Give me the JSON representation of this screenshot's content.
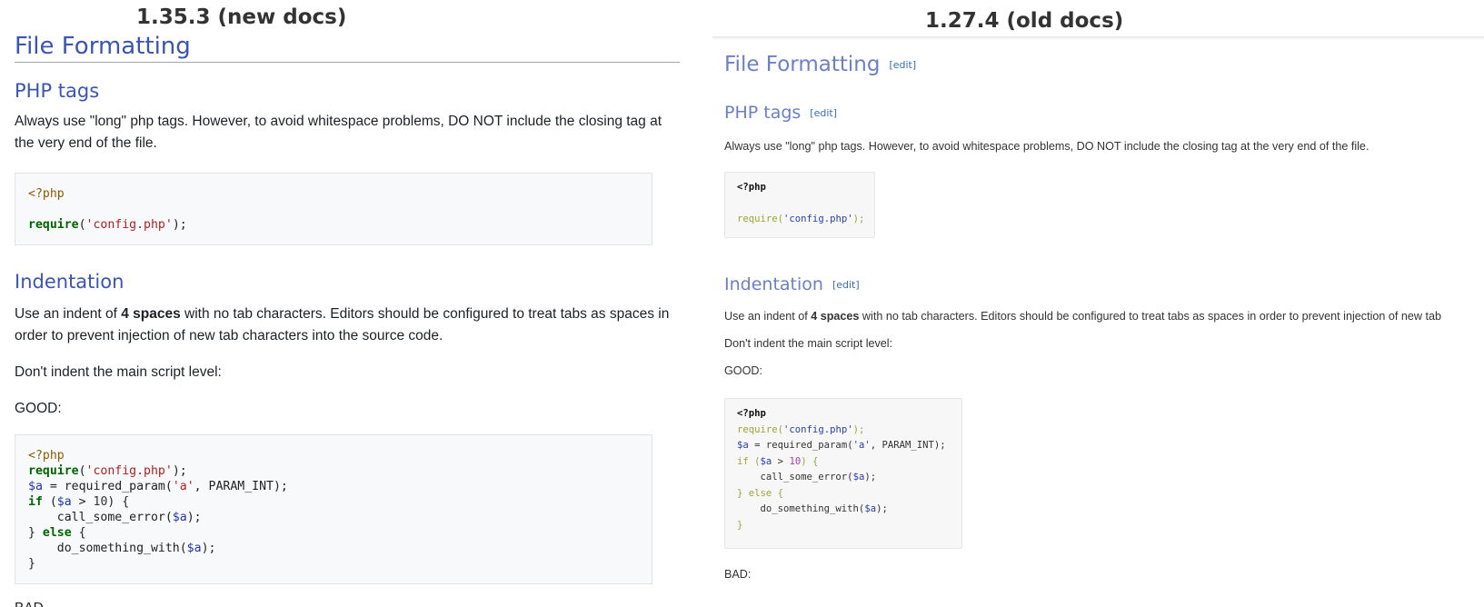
{
  "new_docs": {
    "caption": "1.35.3 (new docs)",
    "h1": "File Formatting",
    "php_tags": {
      "heading": "PHP tags",
      "text": "Always use \"long\" php tags. However, to avoid whitespace problems, DO NOT include the closing tag at the very end of the file.",
      "code_open": "<?php",
      "code_fn": "require",
      "code_arg": "'config.php'",
      "code_end": ");"
    },
    "indentation": {
      "heading": "Indentation",
      "text_before": "Use an indent of ",
      "text_bold": "4 spaces",
      "text_after": " with no tab characters. Editors should be configured to treat tabs as spaces in order to prevent injection of new tab characters into the source code.",
      "text2": "Don't indent the main script level:",
      "good": "GOOD:",
      "code": {
        "open": "<?php",
        "l2_fn": "require",
        "l2_open": "(",
        "l2_str": "'config.php'",
        "l2_end": ");",
        "l3_var": "$a",
        "l3_mid": " = required_param(",
        "l3_str": "'a'",
        "l3_end": ", PARAM_INT);",
        "l4_kw": "if",
        "l4_open": " (",
        "l4_var": "$a",
        "l4_op": " > ",
        "l4_num": "10",
        "l4_end": ") {",
        "l5_fn": "    call_some_error(",
        "l5_var": "$a",
        "l5_end": ");",
        "l6_open": "} ",
        "l6_kw": "else",
        "l6_end": " {",
        "l7_fn": "    do_something_with(",
        "l7_var": "$a",
        "l7_end": ");",
        "l8": "}"
      },
      "bad_partial": "BAD"
    }
  },
  "old_docs": {
    "caption": "1.27.4 (old docs)",
    "h1": "File Formatting",
    "edit_label": "[edit]",
    "php_tags": {
      "heading": "PHP tags",
      "text": "Always use \"long\" php tags. However, to avoid whitespace problems, DO NOT include the closing tag at the very end of the file.",
      "code_open": "<?php",
      "code_fn": "require",
      "code_open_paren": "(",
      "code_arg": "'config.php'",
      "code_end": ");"
    },
    "indentation": {
      "heading": "Indentation",
      "text_before": "Use an indent of ",
      "text_bold": "4 spaces",
      "text_after": " with no tab characters. Editors should be configured to treat tabs as spaces in order to prevent injection of new tab",
      "text2": "Don't indent the main script level:",
      "good": "GOOD:",
      "code": {
        "open": "<?php",
        "l2_fn": "require",
        "l2_open": "(",
        "l2_str": "'config.php'",
        "l2_end": ");",
        "l3_var": "$a",
        "l3_mid": " = required_param(",
        "l3_str": "'a'",
        "l3_end": ", PARAM_INT);",
        "l4_kw": "if",
        "l4_open": " (",
        "l4_var": "$a",
        "l4_op": " > ",
        "l4_num": "10",
        "l4_end": ") {",
        "l5_fn": "    call_some_error(",
        "l5_var": "$a",
        "l5_end": ");",
        "l6_open": "} ",
        "l6_kw": "else",
        "l6_end": " {",
        "l7_fn": "    do_something_with(",
        "l7_var": "$a",
        "l7_end": ");",
        "l8": "}"
      },
      "bad": "BAD:"
    }
  }
}
